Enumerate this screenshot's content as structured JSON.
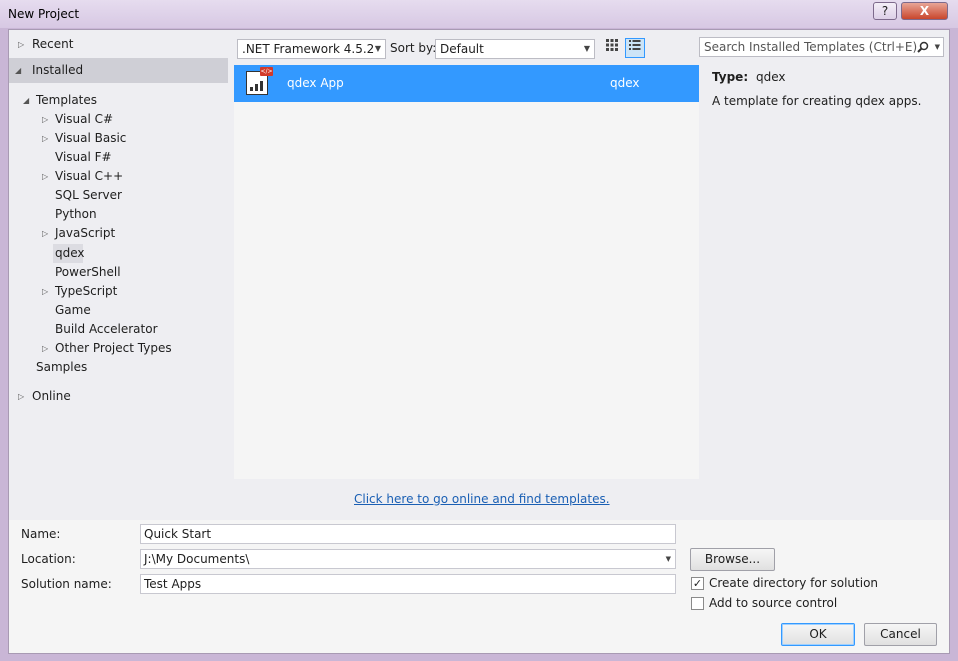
{
  "window": {
    "title": "New Project",
    "help": "?",
    "close": "X"
  },
  "nav": {
    "recent": "Recent",
    "installed": "Installed",
    "templates": "Templates",
    "items": [
      "Visual C#",
      "Visual Basic",
      "Visual F#",
      "Visual C++",
      "SQL Server",
      "Python",
      "JavaScript",
      "qdex",
      "PowerShell",
      "TypeScript",
      "Game",
      "Build Accelerator",
      "Other Project Types"
    ],
    "samples": "Samples",
    "online": "Online"
  },
  "toolbar": {
    "framework": ".NET Framework 4.5.2",
    "sort_label": "Sort by:",
    "sort_value": "Default",
    "search_placeholder": "Search Installed Templates (Ctrl+E)"
  },
  "list": {
    "rows": [
      {
        "name": "qdex App",
        "lang": "qdex"
      }
    ]
  },
  "details": {
    "type_label": "Type:",
    "type_value": "qdex",
    "description": "A template for creating qdex apps."
  },
  "online_link": "Click here to go online and find templates.",
  "form": {
    "name_label": "Name:",
    "name_value": "Quick Start",
    "location_label": "Location:",
    "location_value": "J:\\My Documents\\",
    "solution_label": "Solution name:",
    "solution_value": "Test Apps",
    "browse": "Browse...",
    "create_dir": "Create directory for solution",
    "add_source": "Add to source control",
    "ok": "OK",
    "cancel": "Cancel"
  },
  "colors": {
    "accent": "#3399ff",
    "panel": "#eeeef2",
    "frame": "#c9b6d6"
  }
}
